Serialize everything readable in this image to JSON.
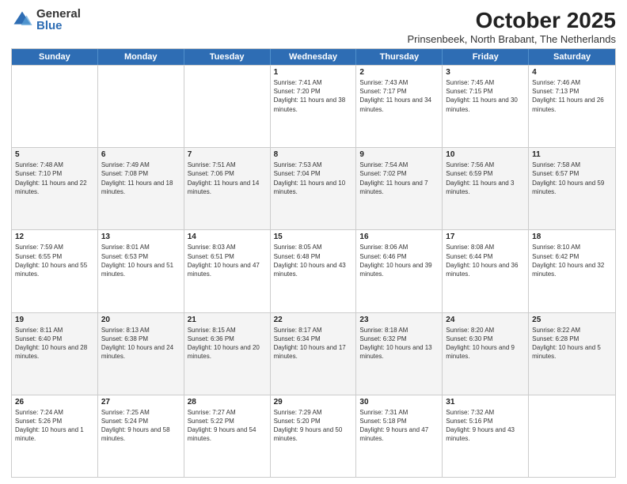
{
  "logo": {
    "general": "General",
    "blue": "Blue"
  },
  "title": "October 2025",
  "subtitle": "Prinsenbeek, North Brabant, The Netherlands",
  "days": [
    "Sunday",
    "Monday",
    "Tuesday",
    "Wednesday",
    "Thursday",
    "Friday",
    "Saturday"
  ],
  "weeks": [
    [
      {
        "day": "",
        "sunrise": "",
        "sunset": "",
        "daylight": ""
      },
      {
        "day": "",
        "sunrise": "",
        "sunset": "",
        "daylight": ""
      },
      {
        "day": "",
        "sunrise": "",
        "sunset": "",
        "daylight": ""
      },
      {
        "day": "1",
        "sunrise": "Sunrise: 7:41 AM",
        "sunset": "Sunset: 7:20 PM",
        "daylight": "Daylight: 11 hours and 38 minutes."
      },
      {
        "day": "2",
        "sunrise": "Sunrise: 7:43 AM",
        "sunset": "Sunset: 7:17 PM",
        "daylight": "Daylight: 11 hours and 34 minutes."
      },
      {
        "day": "3",
        "sunrise": "Sunrise: 7:45 AM",
        "sunset": "Sunset: 7:15 PM",
        "daylight": "Daylight: 11 hours and 30 minutes."
      },
      {
        "day": "4",
        "sunrise": "Sunrise: 7:46 AM",
        "sunset": "Sunset: 7:13 PM",
        "daylight": "Daylight: 11 hours and 26 minutes."
      }
    ],
    [
      {
        "day": "5",
        "sunrise": "Sunrise: 7:48 AM",
        "sunset": "Sunset: 7:10 PM",
        "daylight": "Daylight: 11 hours and 22 minutes."
      },
      {
        "day": "6",
        "sunrise": "Sunrise: 7:49 AM",
        "sunset": "Sunset: 7:08 PM",
        "daylight": "Daylight: 11 hours and 18 minutes."
      },
      {
        "day": "7",
        "sunrise": "Sunrise: 7:51 AM",
        "sunset": "Sunset: 7:06 PM",
        "daylight": "Daylight: 11 hours and 14 minutes."
      },
      {
        "day": "8",
        "sunrise": "Sunrise: 7:53 AM",
        "sunset": "Sunset: 7:04 PM",
        "daylight": "Daylight: 11 hours and 10 minutes."
      },
      {
        "day": "9",
        "sunrise": "Sunrise: 7:54 AM",
        "sunset": "Sunset: 7:02 PM",
        "daylight": "Daylight: 11 hours and 7 minutes."
      },
      {
        "day": "10",
        "sunrise": "Sunrise: 7:56 AM",
        "sunset": "Sunset: 6:59 PM",
        "daylight": "Daylight: 11 hours and 3 minutes."
      },
      {
        "day": "11",
        "sunrise": "Sunrise: 7:58 AM",
        "sunset": "Sunset: 6:57 PM",
        "daylight": "Daylight: 10 hours and 59 minutes."
      }
    ],
    [
      {
        "day": "12",
        "sunrise": "Sunrise: 7:59 AM",
        "sunset": "Sunset: 6:55 PM",
        "daylight": "Daylight: 10 hours and 55 minutes."
      },
      {
        "day": "13",
        "sunrise": "Sunrise: 8:01 AM",
        "sunset": "Sunset: 6:53 PM",
        "daylight": "Daylight: 10 hours and 51 minutes."
      },
      {
        "day": "14",
        "sunrise": "Sunrise: 8:03 AM",
        "sunset": "Sunset: 6:51 PM",
        "daylight": "Daylight: 10 hours and 47 minutes."
      },
      {
        "day": "15",
        "sunrise": "Sunrise: 8:05 AM",
        "sunset": "Sunset: 6:48 PM",
        "daylight": "Daylight: 10 hours and 43 minutes."
      },
      {
        "day": "16",
        "sunrise": "Sunrise: 8:06 AM",
        "sunset": "Sunset: 6:46 PM",
        "daylight": "Daylight: 10 hours and 39 minutes."
      },
      {
        "day": "17",
        "sunrise": "Sunrise: 8:08 AM",
        "sunset": "Sunset: 6:44 PM",
        "daylight": "Daylight: 10 hours and 36 minutes."
      },
      {
        "day": "18",
        "sunrise": "Sunrise: 8:10 AM",
        "sunset": "Sunset: 6:42 PM",
        "daylight": "Daylight: 10 hours and 32 minutes."
      }
    ],
    [
      {
        "day": "19",
        "sunrise": "Sunrise: 8:11 AM",
        "sunset": "Sunset: 6:40 PM",
        "daylight": "Daylight: 10 hours and 28 minutes."
      },
      {
        "day": "20",
        "sunrise": "Sunrise: 8:13 AM",
        "sunset": "Sunset: 6:38 PM",
        "daylight": "Daylight: 10 hours and 24 minutes."
      },
      {
        "day": "21",
        "sunrise": "Sunrise: 8:15 AM",
        "sunset": "Sunset: 6:36 PM",
        "daylight": "Daylight: 10 hours and 20 minutes."
      },
      {
        "day": "22",
        "sunrise": "Sunrise: 8:17 AM",
        "sunset": "Sunset: 6:34 PM",
        "daylight": "Daylight: 10 hours and 17 minutes."
      },
      {
        "day": "23",
        "sunrise": "Sunrise: 8:18 AM",
        "sunset": "Sunset: 6:32 PM",
        "daylight": "Daylight: 10 hours and 13 minutes."
      },
      {
        "day": "24",
        "sunrise": "Sunrise: 8:20 AM",
        "sunset": "Sunset: 6:30 PM",
        "daylight": "Daylight: 10 hours and 9 minutes."
      },
      {
        "day": "25",
        "sunrise": "Sunrise: 8:22 AM",
        "sunset": "Sunset: 6:28 PM",
        "daylight": "Daylight: 10 hours and 5 minutes."
      }
    ],
    [
      {
        "day": "26",
        "sunrise": "Sunrise: 7:24 AM",
        "sunset": "Sunset: 5:26 PM",
        "daylight": "Daylight: 10 hours and 1 minute."
      },
      {
        "day": "27",
        "sunrise": "Sunrise: 7:25 AM",
        "sunset": "Sunset: 5:24 PM",
        "daylight": "Daylight: 9 hours and 58 minutes."
      },
      {
        "day": "28",
        "sunrise": "Sunrise: 7:27 AM",
        "sunset": "Sunset: 5:22 PM",
        "daylight": "Daylight: 9 hours and 54 minutes."
      },
      {
        "day": "29",
        "sunrise": "Sunrise: 7:29 AM",
        "sunset": "Sunset: 5:20 PM",
        "daylight": "Daylight: 9 hours and 50 minutes."
      },
      {
        "day": "30",
        "sunrise": "Sunrise: 7:31 AM",
        "sunset": "Sunset: 5:18 PM",
        "daylight": "Daylight: 9 hours and 47 minutes."
      },
      {
        "day": "31",
        "sunrise": "Sunrise: 7:32 AM",
        "sunset": "Sunset: 5:16 PM",
        "daylight": "Daylight: 9 hours and 43 minutes."
      },
      {
        "day": "",
        "sunrise": "",
        "sunset": "",
        "daylight": ""
      }
    ]
  ]
}
